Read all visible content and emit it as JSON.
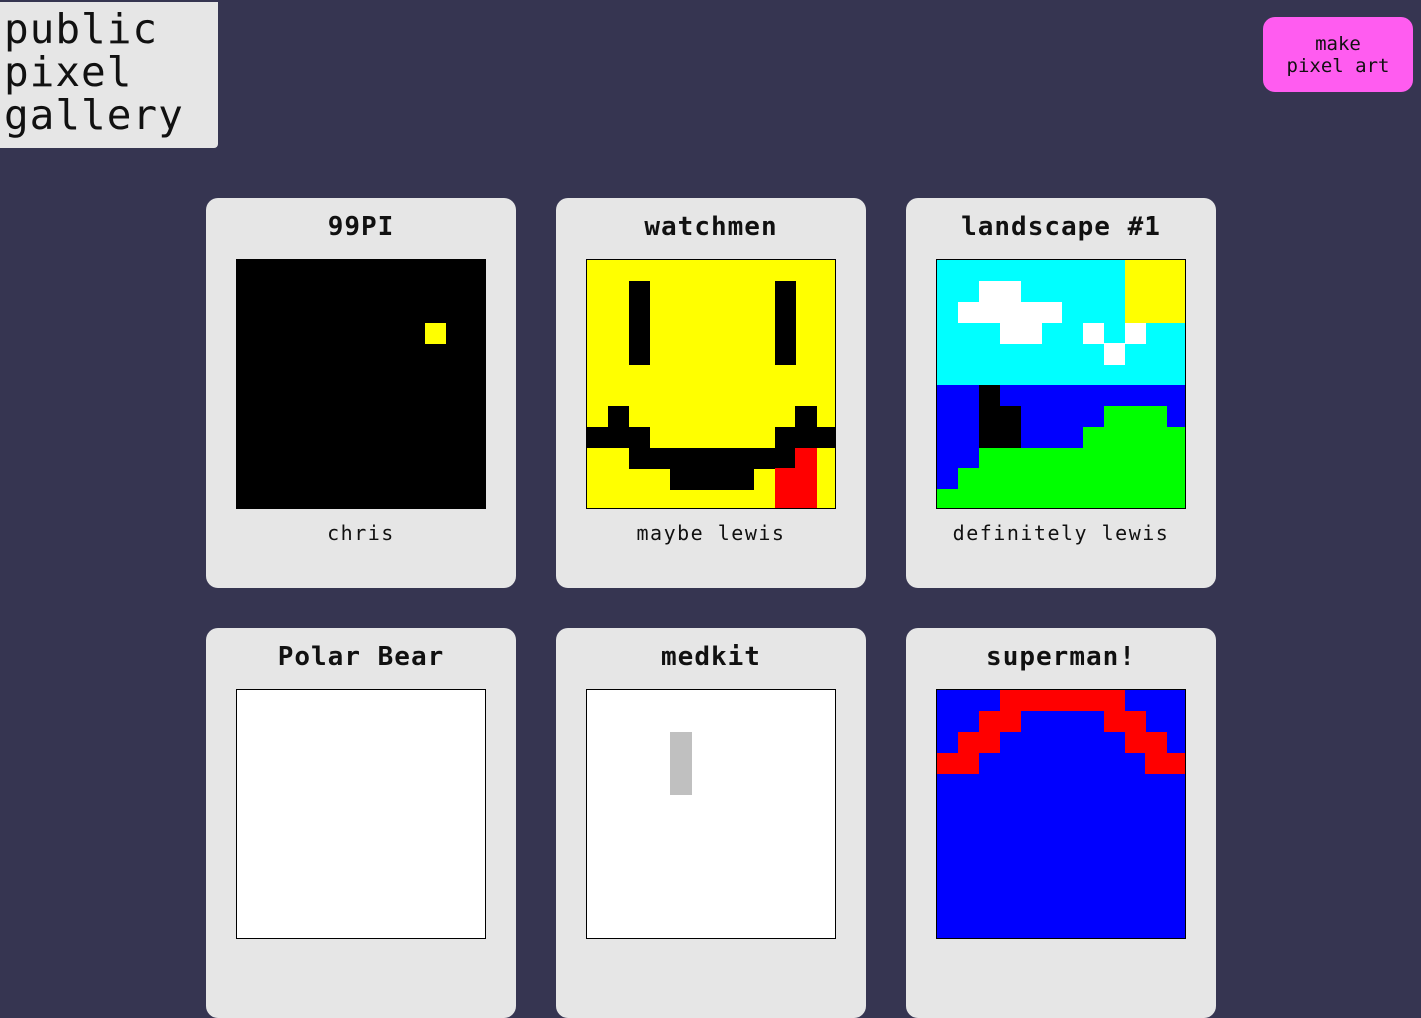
{
  "logo": {
    "lines": [
      "public",
      "pixel",
      "gallery"
    ]
  },
  "make_button": {
    "line1": "make",
    "line2": "pixel art",
    "color": "#ff5cf0"
  },
  "colors": {
    "background": "#363551",
    "card": "#e6e6e6"
  },
  "cards": [
    {
      "title": "99PI",
      "author": "chris"
    },
    {
      "title": "watchmen",
      "author": "maybe lewis"
    },
    {
      "title": "landscape #1",
      "author": "definitely lewis"
    },
    {
      "title": "Polar Bear",
      "author": ""
    },
    {
      "title": "medkit",
      "author": ""
    },
    {
      "title": "superman!",
      "author": ""
    }
  ]
}
